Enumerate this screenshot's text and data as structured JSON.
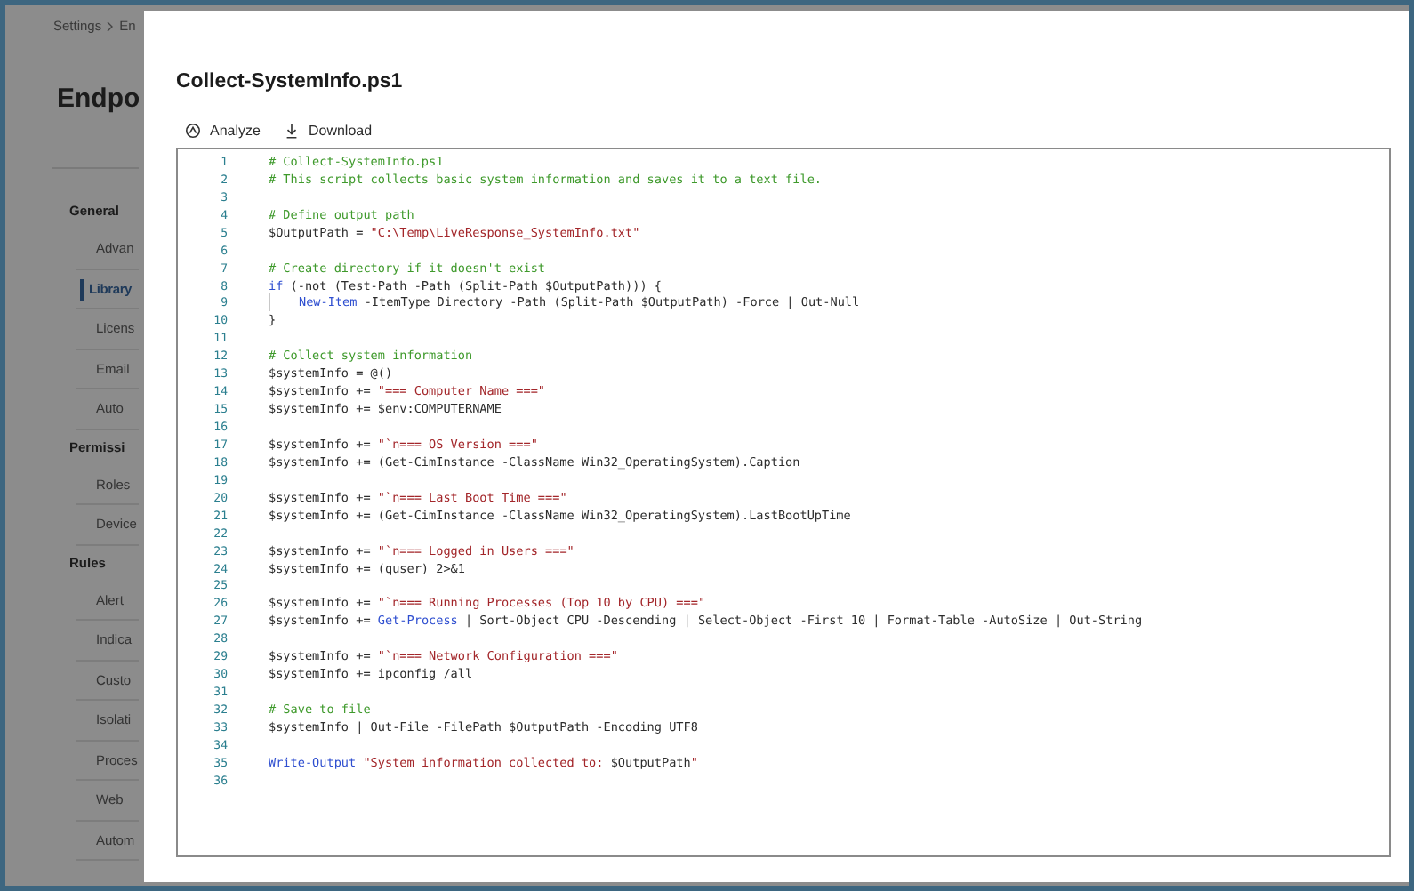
{
  "background": {
    "breadcrumb": [
      "Settings",
      "En"
    ],
    "title": "Endpo",
    "nav": [
      {
        "kind": "heading",
        "label": "General"
      },
      {
        "kind": "item",
        "label": "Advan",
        "selected": false
      },
      {
        "kind": "item",
        "label": "Library",
        "selected": true
      },
      {
        "kind": "item",
        "label": "Licens",
        "selected": false
      },
      {
        "kind": "item",
        "label": "Email",
        "selected": false
      },
      {
        "kind": "item",
        "label": "Auto",
        "selected": false
      },
      {
        "kind": "heading",
        "label": "Permissi"
      },
      {
        "kind": "item",
        "label": "Roles",
        "selected": false
      },
      {
        "kind": "item",
        "label": "Device",
        "selected": false
      },
      {
        "kind": "heading",
        "label": "Rules"
      },
      {
        "kind": "item",
        "label": "Alert",
        "selected": false
      },
      {
        "kind": "item",
        "label": "Indica",
        "selected": false
      },
      {
        "kind": "item",
        "label": "Custo",
        "selected": false
      },
      {
        "kind": "item",
        "label": "Isolati",
        "selected": false
      },
      {
        "kind": "item",
        "label": "Proces",
        "selected": false
      },
      {
        "kind": "item",
        "label": "Web",
        "selected": false
      },
      {
        "kind": "item",
        "label": "Autom",
        "selected": false
      }
    ]
  },
  "panel": {
    "title": "Collect-SystemInfo.ps1",
    "actions": [
      {
        "kind": "analyze",
        "label": "Analyze"
      },
      {
        "kind": "download",
        "label": "Download"
      }
    ],
    "lines": [
      {
        "number": "1",
        "tokens": [
          {
            "kind": "comment",
            "text": "# Collect-SystemInfo.ps1"
          }
        ]
      },
      {
        "number": "2",
        "tokens": [
          {
            "kind": "comment",
            "text": "# This script collects basic system information and saves it to a text file."
          }
        ]
      },
      {
        "number": "3"
      },
      {
        "number": "4",
        "tokens": [
          {
            "kind": "comment",
            "text": "# Define output path"
          }
        ]
      },
      {
        "number": "5",
        "tokens": [
          {
            "kind": "plain",
            "text": "$OutputPath = "
          },
          {
            "kind": "string",
            "text": "\"C:\\Temp\\LiveResponse_SystemInfo.txt\""
          }
        ]
      },
      {
        "number": "6"
      },
      {
        "number": "7",
        "tokens": [
          {
            "kind": "comment",
            "text": "# Create directory if it doesn't exist"
          }
        ]
      },
      {
        "number": "8",
        "tokens": [
          {
            "kind": "keyword",
            "text": "if"
          },
          {
            "kind": "plain",
            "text": " (-not (Test-Path -Path (Split-Path $OutputPath))) {"
          }
        ]
      },
      {
        "number": "9",
        "indent": true,
        "tokens": [
          {
            "kind": "keyword",
            "text": "New-Item"
          },
          {
            "kind": "plain",
            "text": " -ItemType Directory -Path (Split-Path $OutputPath) -Force | Out-Null"
          }
        ]
      },
      {
        "number": "10",
        "tokens": [
          {
            "kind": "plain",
            "text": "}"
          }
        ]
      },
      {
        "number": "11"
      },
      {
        "number": "12",
        "tokens": [
          {
            "kind": "comment",
            "text": "# Collect system information"
          }
        ]
      },
      {
        "number": "13",
        "tokens": [
          {
            "kind": "plain",
            "text": "$systemInfo = @()"
          }
        ]
      },
      {
        "number": "14",
        "tokens": [
          {
            "kind": "plain",
            "text": "$systemInfo += "
          },
          {
            "kind": "string",
            "text": "\"=== Computer Name ===\""
          }
        ]
      },
      {
        "number": "15",
        "tokens": [
          {
            "kind": "plain",
            "text": "$systemInfo += $env:COMPUTERNAME"
          }
        ]
      },
      {
        "number": "16"
      },
      {
        "number": "17",
        "tokens": [
          {
            "kind": "plain",
            "text": "$systemInfo += "
          },
          {
            "kind": "string",
            "text": "\"`n=== OS Version ===\""
          }
        ]
      },
      {
        "number": "18",
        "tokens": [
          {
            "kind": "plain",
            "text": "$systemInfo += (Get-CimInstance -ClassName Win32_OperatingSystem).Caption"
          }
        ]
      },
      {
        "number": "19"
      },
      {
        "number": "20",
        "tokens": [
          {
            "kind": "plain",
            "text": "$systemInfo += "
          },
          {
            "kind": "string",
            "text": "\"`n=== Last Boot Time ===\""
          }
        ]
      },
      {
        "number": "21",
        "tokens": [
          {
            "kind": "plain",
            "text": "$systemInfo += (Get-CimInstance -ClassName Win32_OperatingSystem).LastBootUpTime"
          }
        ]
      },
      {
        "number": "22"
      },
      {
        "number": "23",
        "tokens": [
          {
            "kind": "plain",
            "text": "$systemInfo += "
          },
          {
            "kind": "string",
            "text": "\"`n=== Logged in Users ===\""
          }
        ]
      },
      {
        "number": "24",
        "tokens": [
          {
            "kind": "plain",
            "text": "$systemInfo += (quser) 2>&1"
          }
        ]
      },
      {
        "number": "25"
      },
      {
        "number": "26",
        "tokens": [
          {
            "kind": "plain",
            "text": "$systemInfo += "
          },
          {
            "kind": "string",
            "text": "\"`n=== Running Processes (Top 10 by CPU) ===\""
          }
        ]
      },
      {
        "number": "27",
        "tokens": [
          {
            "kind": "plain",
            "text": "$systemInfo += "
          },
          {
            "kind": "keyword",
            "text": "Get-Process"
          },
          {
            "kind": "plain",
            "text": " | Sort-Object CPU -Descending | Select-Object -First 10 | Format-Table -AutoSize | Out-String"
          }
        ]
      },
      {
        "number": "28"
      },
      {
        "number": "29",
        "tokens": [
          {
            "kind": "plain",
            "text": "$systemInfo += "
          },
          {
            "kind": "string",
            "text": "\"`n=== Network Configuration ===\""
          }
        ]
      },
      {
        "number": "30",
        "tokens": [
          {
            "kind": "plain",
            "text": "$systemInfo += ipconfig /all"
          }
        ]
      },
      {
        "number": "31"
      },
      {
        "number": "32",
        "tokens": [
          {
            "kind": "comment",
            "text": "# Save to file"
          }
        ]
      },
      {
        "number": "33",
        "tokens": [
          {
            "kind": "plain",
            "text": "$systemInfo | Out-File -FilePath $OutputPath -Encoding UTF8"
          }
        ]
      },
      {
        "number": "34"
      },
      {
        "number": "35",
        "tokens": [
          {
            "kind": "keyword",
            "text": "Write-Output"
          },
          {
            "kind": "string",
            "text": " \"System information collected to: "
          },
          {
            "kind": "plain",
            "text": "$OutputPath"
          },
          {
            "kind": "string",
            "text": "\""
          }
        ]
      },
      {
        "number": "36"
      }
    ]
  }
}
